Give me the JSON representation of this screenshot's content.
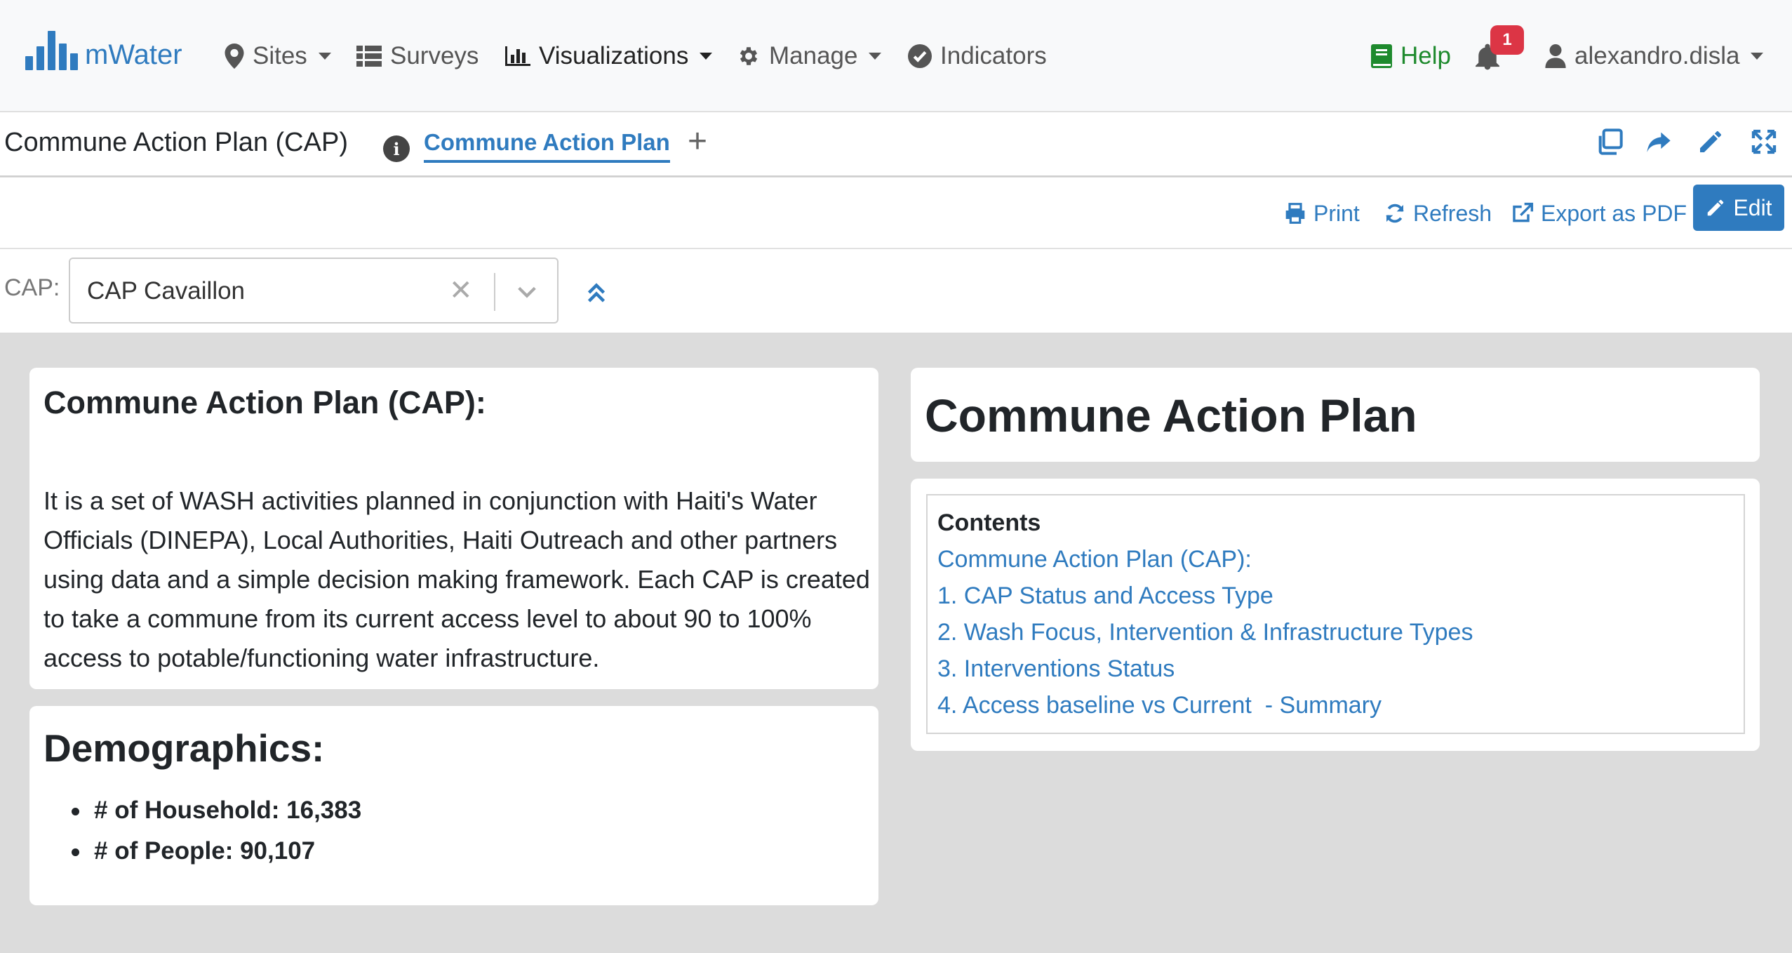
{
  "navbar": {
    "brand": "mWater",
    "sites": "Sites",
    "surveys": "Surveys",
    "visualizations": "Visualizations",
    "manage": "Manage",
    "indicators": "Indicators",
    "help": "Help",
    "notification_count": "1",
    "user": "alexandro.disla"
  },
  "dashboard": {
    "title": "Commune Action Plan (CAP)",
    "tabs": [
      {
        "label": "Commune Action Plan"
      }
    ]
  },
  "actions": {
    "print": "Print",
    "refresh": "Refresh",
    "export_pdf": "Export as PDF",
    "edit": "Edit"
  },
  "filter": {
    "label": "CAP:",
    "value": "CAP Cavaillon"
  },
  "cap_widget": {
    "heading": "Commune Action Plan (CAP):",
    "text": "It is a set of WASH activities planned in conjunction with Haiti's Water Officials (DINEPA), Local Authorities, Haiti Outreach and other partners using data and a simple decision making framework. Each CAP is created to take a commune from its current access level to about 90 to 100% access to potable/functioning water infrastructure."
  },
  "demographics": {
    "heading": "Demographics:",
    "items": [
      "# of Household: 16,383",
      "# of People: 90,107"
    ]
  },
  "title_widget": {
    "text": "Commune Action Plan"
  },
  "toc": {
    "heading": "Contents",
    "items": [
      "Commune Action Plan (CAP):",
      "1. CAP Status and Access Type",
      "2. Wash Focus, Intervention & Infrastructure Types",
      "3. Interventions Status",
      "4. Access baseline vs Current  - Summary"
    ]
  },
  "colors": {
    "accent": "#2f7bbf",
    "help": "#1e8a2d",
    "badge": "#dc3545",
    "canvas": "#dcdcdc"
  }
}
